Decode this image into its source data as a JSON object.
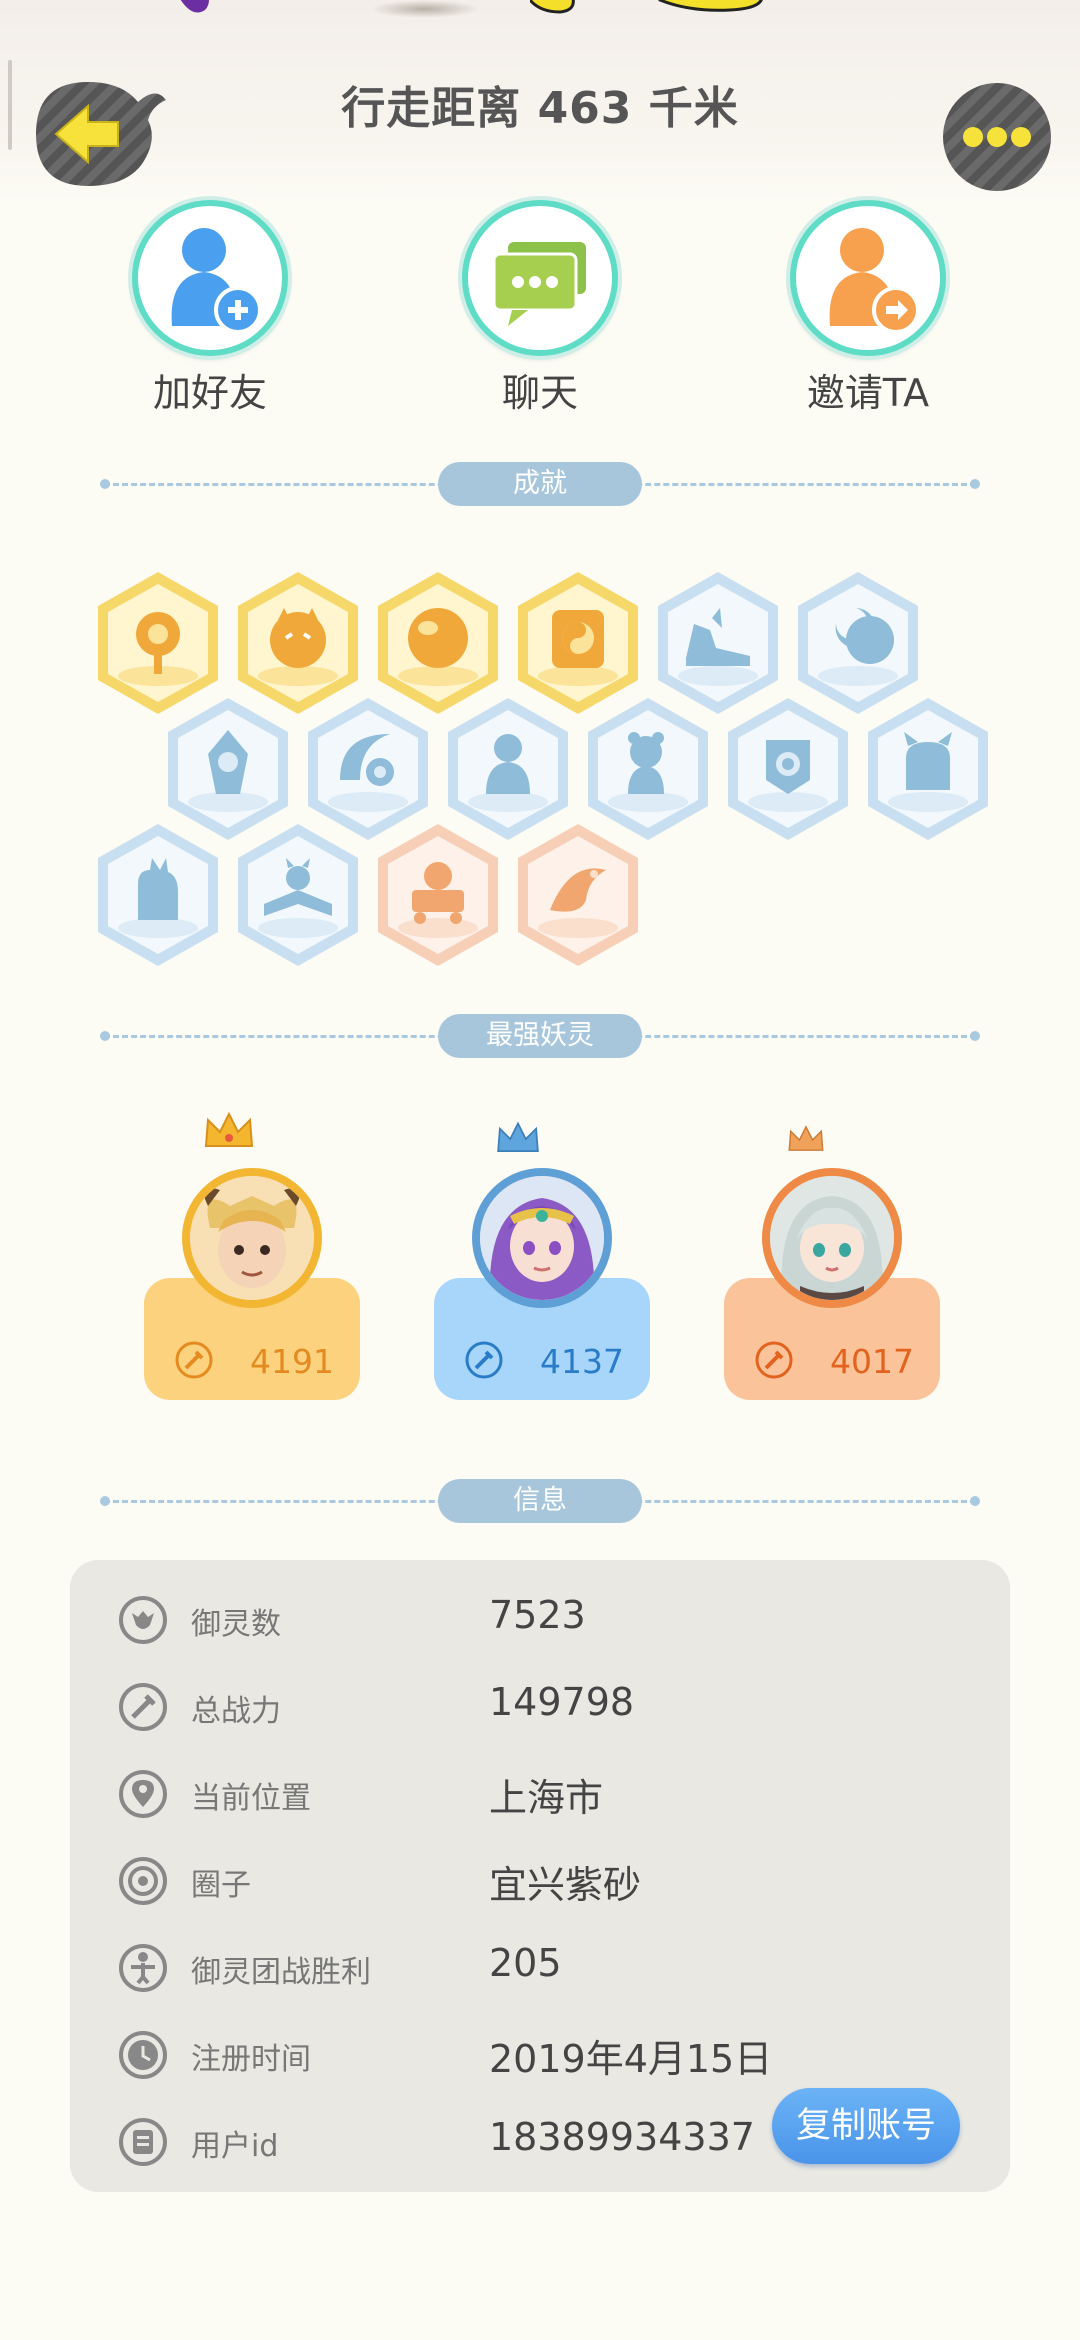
{
  "header": {
    "title": "行走距离 463 千米",
    "back_icon": "back-arrow-icon",
    "more_icon": "more-dots-icon"
  },
  "actions": [
    {
      "label": "加好友",
      "icon": "add-friend-icon"
    },
    {
      "label": "聊天",
      "icon": "chat-icon"
    },
    {
      "label": "邀请TA",
      "icon": "invite-icon"
    }
  ],
  "sections": {
    "achievements": "成就",
    "strongest": "最强妖灵",
    "info": "信息"
  },
  "achievements": [
    {
      "icon": "sun-badge-icon",
      "tier": "gold"
    },
    {
      "icon": "fox-face-badge-icon",
      "tier": "gold"
    },
    {
      "icon": "golden-orb-badge-icon",
      "tier": "gold"
    },
    {
      "icon": "yin-yang-box-badge-icon",
      "tier": "gold"
    },
    {
      "icon": "sneaker-badge-icon",
      "tier": "blue"
    },
    {
      "icon": "moon-badge-icon",
      "tier": "blue"
    },
    {
      "icon": "crystal-badge-icon",
      "tier": "blue"
    },
    {
      "icon": "yin-yang-wave-badge-icon",
      "tier": "blue"
    },
    {
      "icon": "spirit-figure-badge-icon",
      "tier": "blue"
    },
    {
      "icon": "bear-badge-icon",
      "tier": "blue"
    },
    {
      "icon": "shield-badge-icon",
      "tier": "blue"
    },
    {
      "icon": "horned-creature-badge-icon",
      "tier": "blue"
    },
    {
      "icon": "cat-silhouette-badge-icon",
      "tier": "blue"
    },
    {
      "icon": "book-fox-badge-icon",
      "tier": "blue"
    },
    {
      "icon": "cart-cat-badge-icon",
      "tier": "orange"
    },
    {
      "icon": "koi-fish-badge-icon",
      "tier": "orange"
    }
  ],
  "strongest_spirits": [
    {
      "power": "4191",
      "theme": "gold",
      "icon": "horned-warrior-avatar",
      "power_icon": "combat-power-icon"
    },
    {
      "power": "4137",
      "theme": "blue",
      "icon": "purple-hair-girl-avatar",
      "power_icon": "combat-power-icon"
    },
    {
      "power": "4017",
      "theme": "orange",
      "icon": "silver-hair-girl-avatar",
      "power_icon": "combat-power-icon"
    }
  ],
  "info": {
    "rows": [
      {
        "label": "御灵数",
        "value": "7523",
        "icon": "spirit-count-icon"
      },
      {
        "label": "总战力",
        "value": "149798",
        "icon": "total-power-icon"
      },
      {
        "label": "当前位置",
        "value": "上海市",
        "icon": "location-pin-icon"
      },
      {
        "label": "圈子",
        "value": "宜兴紫砂",
        "icon": "circle-group-icon"
      },
      {
        "label": "御灵团战胜利",
        "value": "205",
        "icon": "team-battle-icon"
      },
      {
        "label": "注册时间",
        "value": "2019年4月15日",
        "icon": "clock-icon"
      },
      {
        "label": "用户id",
        "value": "18389934337",
        "icon": "user-id-icon"
      }
    ],
    "copy_button": "复制账号"
  },
  "colors": {
    "gold": "#f7c54a",
    "blue": "#8ec4f0",
    "orange": "#f8b484",
    "accent_button": "#4a94ea",
    "section_pill": "#a7c6dc"
  }
}
